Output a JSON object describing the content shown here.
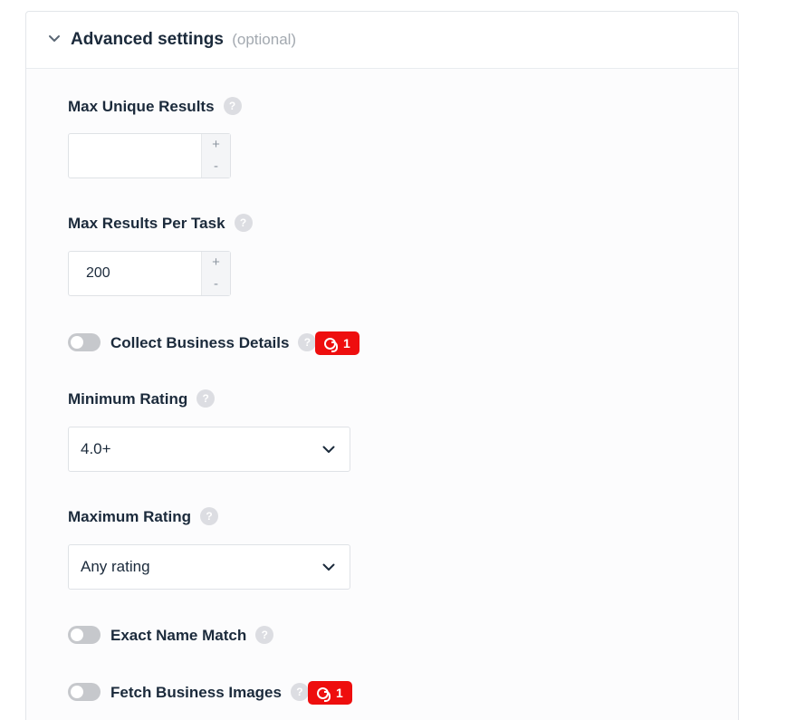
{
  "section": {
    "title": "Advanced settings",
    "optional_label": "(optional)",
    "help_glyph": "?"
  },
  "fields": {
    "max_unique_results": {
      "label": "Max Unique Results",
      "value": "",
      "increment": "+",
      "decrement": "-"
    },
    "max_results_per_task": {
      "label": "Max Results Per Task",
      "value": "200",
      "increment": "+",
      "decrement": "-"
    },
    "collect_business_details": {
      "label": "Collect Business Details",
      "enabled": false,
      "credit_cost": "1"
    },
    "minimum_rating": {
      "label": "Minimum Rating",
      "selected": "4.0+"
    },
    "maximum_rating": {
      "label": "Maximum Rating",
      "selected": "Any rating"
    },
    "exact_name_match": {
      "label": "Exact Name Match",
      "enabled": false
    },
    "fetch_business_images": {
      "label": "Fetch Business Images",
      "enabled": false,
      "credit_cost": "1"
    }
  },
  "icons": {
    "collapse": "chevron-down-icon",
    "help": "question-circle-icon",
    "credit": "coin-icon",
    "dropdown": "chevron-down-icon"
  },
  "colors": {
    "badge": "#ee0e0e",
    "toggle_off": "#c6c8cc",
    "text": "#1b2a3b",
    "muted": "#a3a9b0"
  }
}
